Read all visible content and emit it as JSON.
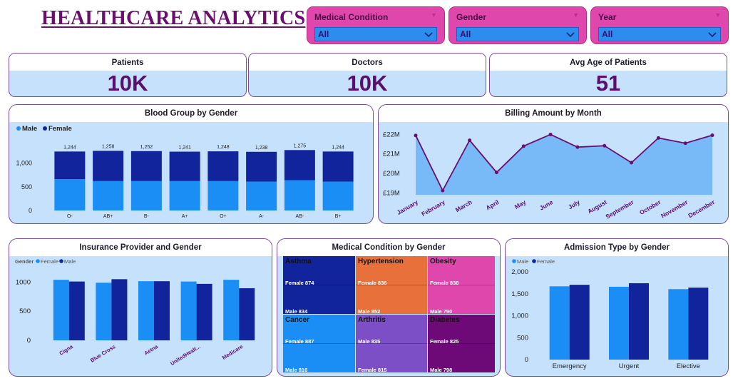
{
  "header": {
    "title": "HEALTHCARE ANALYTICS"
  },
  "slicers": [
    {
      "label": "Medical Condition",
      "value": "All"
    },
    {
      "label": "Gender",
      "value": "All"
    },
    {
      "label": "Year",
      "value": "All"
    }
  ],
  "kpis": [
    {
      "label": "Patients",
      "value": "10K"
    },
    {
      "label": "Doctors",
      "value": "10K"
    },
    {
      "label": "Avg Age of Patients",
      "value": "51"
    }
  ],
  "colors": {
    "male": "#1a8ef5",
    "female": "#12249c",
    "area": "#78b9f7",
    "line": "#6a0f6e",
    "slicer": "#df47ad",
    "panel": "#c6e1fb"
  },
  "chart_data": [
    {
      "id": "blood",
      "type": "bar",
      "stacked": true,
      "title": "Blood Group by Gender",
      "legend_position": "top-left",
      "categories": [
        "O-",
        "AB+",
        "B-",
        "A+",
        "O+",
        "A-",
        "AB-",
        "B+"
      ],
      "series": [
        {
          "name": "Male",
          "values": [
            660,
            620,
            620,
            620,
            620,
            610,
            640,
            610
          ]
        },
        {
          "name": "Female",
          "values": [
            584,
            638,
            632,
            621,
            628,
            628,
            635,
            634
          ]
        }
      ],
      "totals": [
        "1,244",
        "1,258",
        "1,252",
        "1,241",
        "1,248",
        "1,238",
        "1,275",
        "1,244"
      ],
      "yticks": [
        "0",
        "500",
        "1,000"
      ],
      "ylim": [
        0,
        1400
      ]
    },
    {
      "id": "billing",
      "type": "area",
      "title": "Billing Amount by Month",
      "categories": [
        "January",
        "February",
        "March",
        "April",
        "May",
        "June",
        "July",
        "August",
        "September",
        "October",
        "November",
        "December"
      ],
      "values": [
        21.95,
        19.12,
        21.7,
        20.05,
        21.4,
        22.0,
        21.35,
        21.42,
        20.55,
        21.82,
        21.55,
        21.96
      ],
      "yticks": [
        "£19M",
        "£20M",
        "£21M",
        "£22M"
      ],
      "ylim": [
        18.9,
        22.2
      ]
    },
    {
      "id": "insurance",
      "type": "bar",
      "title": "Insurance Provider and Gender",
      "legend_title": "Gender",
      "legend_position": "top-left",
      "categories": [
        "Cigna",
        "Blue Cross",
        "Aetna",
        "UnitedHealt...",
        "Medicare"
      ],
      "series": [
        {
          "name": "Female",
          "values": [
            1040,
            990,
            1015,
            1010,
            1040
          ]
        },
        {
          "name": "Male",
          "values": [
            1010,
            1050,
            1015,
            970,
            895
          ]
        }
      ],
      "yticks": [
        "0",
        "500",
        "1000"
      ],
      "ylim": [
        0,
        1250
      ]
    },
    {
      "id": "medical",
      "type": "treemap",
      "title": "Medical Condition by Gender",
      "cells": [
        {
          "name": "Asthma",
          "female": "Female 874",
          "male": "Male 834",
          "color": "#12249c"
        },
        {
          "name": "Hypertension",
          "female": "Female 836",
          "male": "Male 852",
          "color": "#e8703a"
        },
        {
          "name": "Obesity",
          "female": "Female 838",
          "male": "Male 790",
          "color": "#df47ad"
        },
        {
          "name": "Cancer",
          "female": "Female 887",
          "male": "Male 816",
          "color": "#1a8ef5"
        },
        {
          "name": "Arthritis",
          "female": "Male 835",
          "male": "Female 815",
          "color": "#7c4fc7"
        },
        {
          "name": "Diabetes",
          "female": "Female 825",
          "male": "Male 798",
          "color": "#6e0a78"
        }
      ]
    },
    {
      "id": "admission",
      "type": "bar",
      "title": "Admission Type by Gender",
      "legend_position": "top-left",
      "categories": [
        "Emergency",
        "Urgent",
        "Elective"
      ],
      "series": [
        {
          "name": "Male",
          "values": [
            1670,
            1660,
            1605
          ]
        },
        {
          "name": "Female",
          "values": [
            1705,
            1740,
            1640
          ]
        }
      ],
      "yticks": [
        "0",
        "500",
        "1,000",
        "1,500",
        "2,000"
      ],
      "ylim": [
        0,
        2000
      ]
    }
  ]
}
